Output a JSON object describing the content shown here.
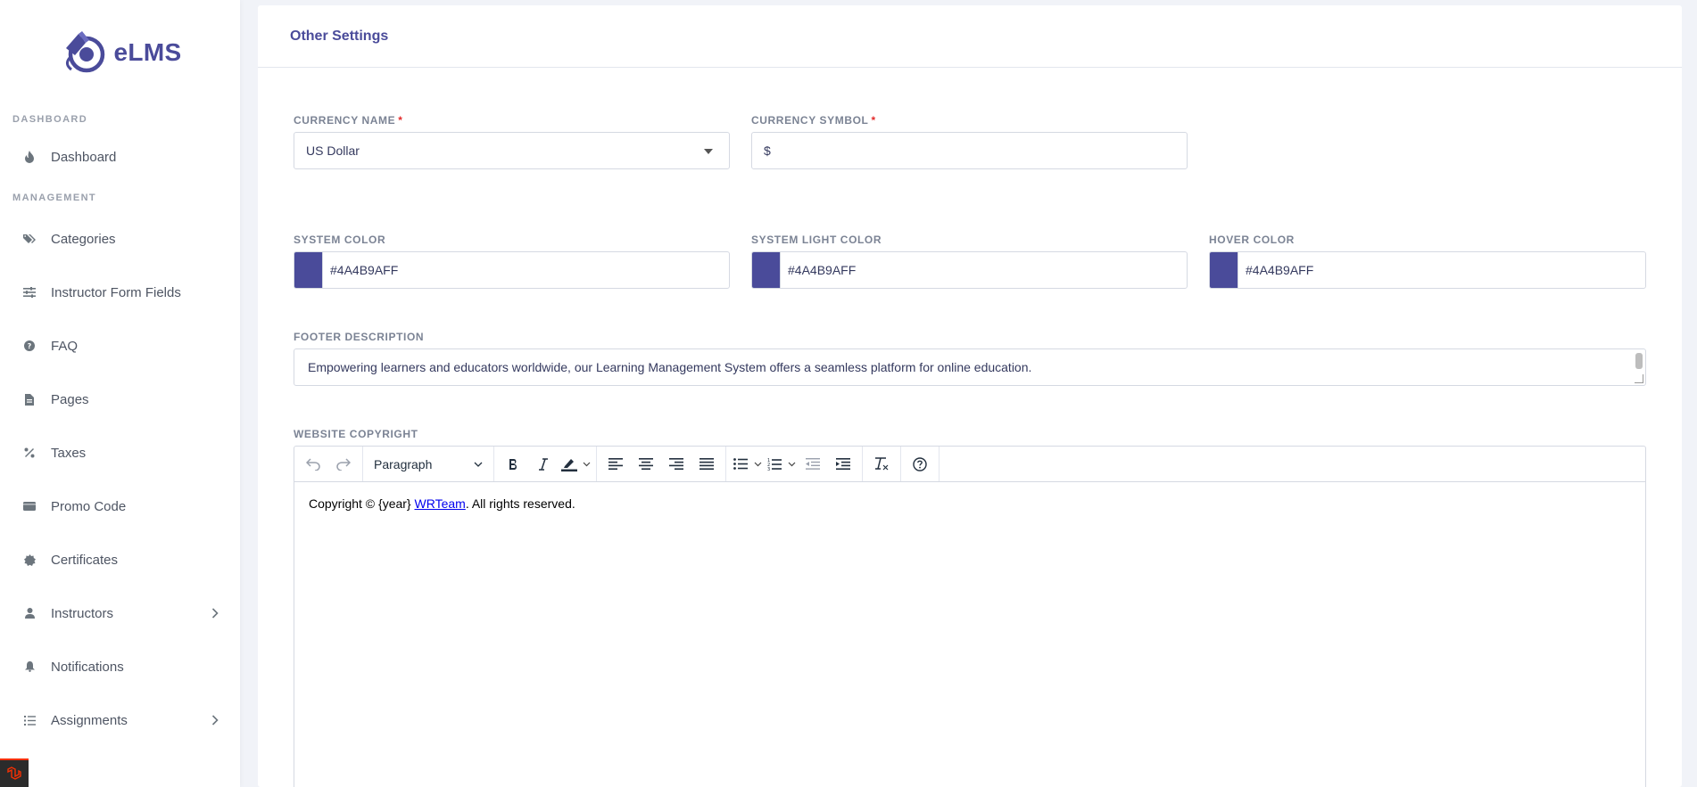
{
  "brand": {
    "name": "eLMS",
    "color": "#4a4b9a"
  },
  "sidebar": {
    "sections": {
      "dashboard": "DASHBOARD",
      "management": "MANAGEMENT"
    },
    "items": [
      {
        "label": "Dashboard",
        "icon": "fire-icon"
      },
      {
        "label": "Categories",
        "icon": "tags-icon"
      },
      {
        "label": "Instructor Form Fields",
        "icon": "sliders-icon"
      },
      {
        "label": "FAQ",
        "icon": "question-circle-icon"
      },
      {
        "label": "Pages",
        "icon": "file-icon"
      },
      {
        "label": "Taxes",
        "icon": "percent-icon"
      },
      {
        "label": "Promo Code",
        "icon": "ticket-icon"
      },
      {
        "label": "Certificates",
        "icon": "certificate-icon"
      },
      {
        "label": "Instructors",
        "icon": "user-icon",
        "has_children": true
      },
      {
        "label": "Notifications",
        "icon": "bell-icon"
      },
      {
        "label": "Assignments",
        "icon": "list-icon",
        "has_children": true
      }
    ]
  },
  "card": {
    "title": "Other Settings"
  },
  "form": {
    "currency_name": {
      "label": "CURRENCY NAME",
      "required_mark": "*",
      "value": "US Dollar"
    },
    "currency_symbol": {
      "label": "CURRENCY SYMBOL",
      "required_mark": "*",
      "value": "$"
    },
    "system_color": {
      "label": "SYSTEM COLOR",
      "value": "#4A4B9AFF"
    },
    "system_light_color": {
      "label": "SYSTEM LIGHT COLOR",
      "value": "#4A4B9AFF"
    },
    "hover_color": {
      "label": "HOVER COLOR",
      "value": "#4A4B9AFF"
    },
    "footer_description": {
      "label": "FOOTER DESCRIPTION",
      "value": "Empowering learners and educators worldwide, our Learning Management System offers a seamless platform for online education."
    },
    "website_copyright": {
      "label": "WEBSITE COPYRIGHT",
      "block_format": "Paragraph",
      "content_prefix": "Copyright © {year} ",
      "content_link": "WRTeam",
      "content_suffix": ". All rights reserved."
    }
  }
}
